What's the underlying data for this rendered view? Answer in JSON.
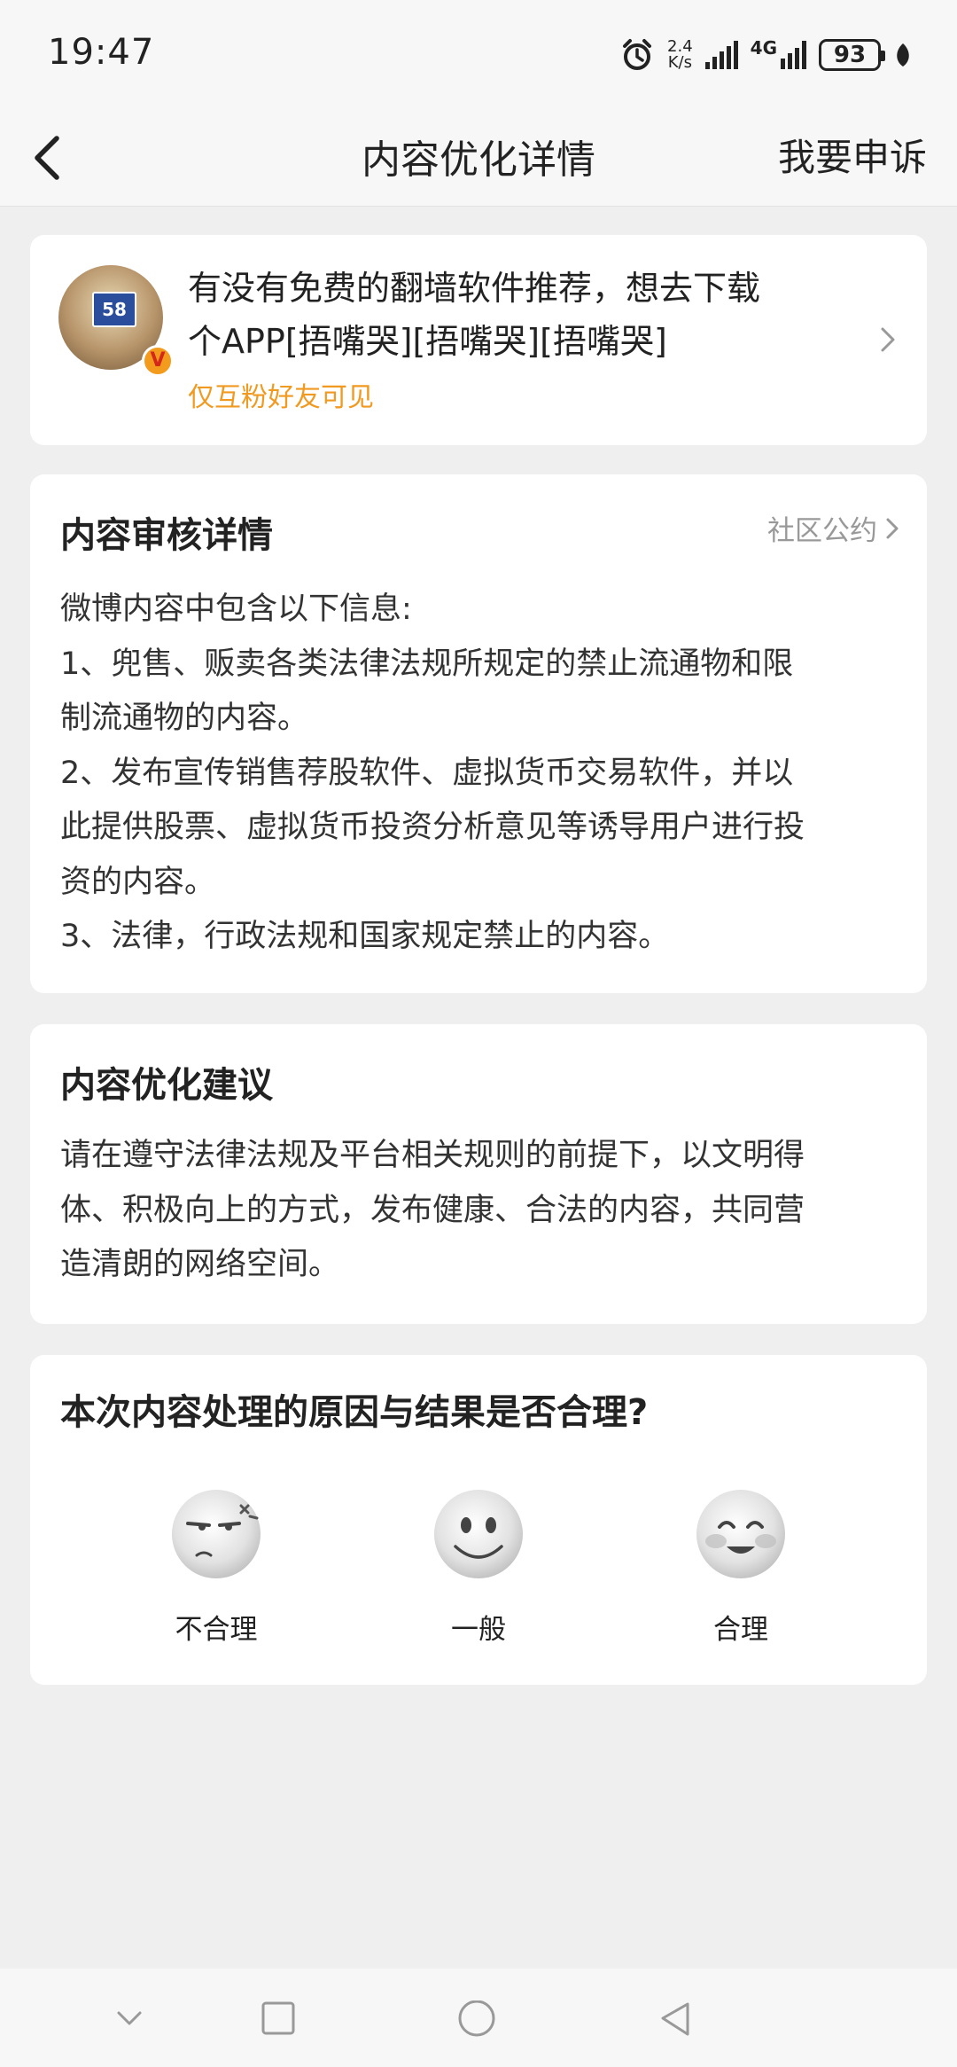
{
  "status_bar": {
    "time": "19:47",
    "net_speed_value": "2.4",
    "net_speed_unit": "K/s",
    "network_type": "4G",
    "battery": "93"
  },
  "nav": {
    "title": "内容优化详情",
    "appeal_label": "我要申诉"
  },
  "post": {
    "avatar_sign_text": "58",
    "verified_badge": "V",
    "text_line1": "有没有免费的翻墙软件推荐，想去下载",
    "text_line2": "个APP[捂嘴哭][捂嘴哭][捂嘴哭]",
    "visibility": "仅互粉好友可见"
  },
  "review": {
    "title": "内容审核详情",
    "community_link": "社区公约",
    "intro": "微博内容中包含以下信息:",
    "item1_line1": "1、兜售、贩卖各类法律法规所规定的禁止流通物和限",
    "item1_line2": "制流通物的内容。",
    "item2_line1": "2、发布宣传销售荐股软件、虚拟货币交易软件，并以",
    "item2_line2": "此提供股票、虚拟货币投资分析意见等诱导用户进行投",
    "item2_line3": "资的内容。",
    "item3": "3、法律，行政法规和国家规定禁止的内容。"
  },
  "suggestion": {
    "title": "内容优化建议",
    "line1": "请在遵守法律法规及平台相关规则的前提下，以文明得",
    "line2": "体、积极向上的方式，发布健康、合法的内容，共同营",
    "line3": "造清朗的网络空间。"
  },
  "feedback": {
    "question": "本次内容处理的原因与结果是否合理?",
    "options": [
      {
        "label": "不合理",
        "icon": "annoyed-face-icon"
      },
      {
        "label": "一般",
        "icon": "neutral-smile-face-icon"
      },
      {
        "label": "合理",
        "icon": "happy-blush-face-icon"
      }
    ]
  },
  "colors": {
    "accent_orange": "#f09a21",
    "page_bg": "#efefef",
    "card_bg": "#ffffff"
  }
}
